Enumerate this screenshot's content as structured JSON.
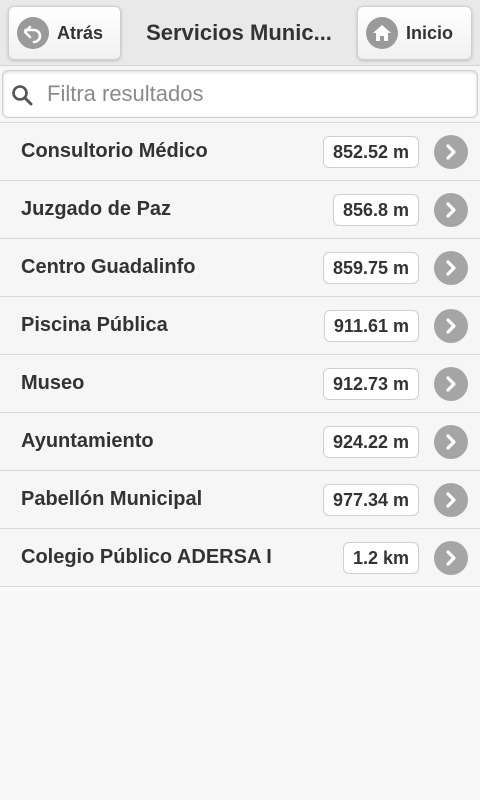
{
  "header": {
    "back_label": "Atrás",
    "title": "Servicios Munic...",
    "home_label": "Inicio"
  },
  "search": {
    "placeholder": "Filtra resultados",
    "value": ""
  },
  "items": [
    {
      "label": "Consultorio Médico",
      "distance": "852.52 m"
    },
    {
      "label": "Juzgado de Paz",
      "distance": "856.8 m"
    },
    {
      "label": "Centro Guadalinfo",
      "distance": "859.75 m"
    },
    {
      "label": "Piscina Pública",
      "distance": "911.61 m"
    },
    {
      "label": "Museo",
      "distance": "912.73 m"
    },
    {
      "label": "Ayuntamiento",
      "distance": "924.22 m"
    },
    {
      "label": "Pabellón Municipal",
      "distance": "977.34 m"
    },
    {
      "label": "Colegio Público ADERSA I",
      "distance": "1.2 km"
    }
  ],
  "icons": {
    "back": "back-arrow-icon",
    "home": "home-icon",
    "search": "search-icon",
    "row": "chevron-right-icon"
  }
}
